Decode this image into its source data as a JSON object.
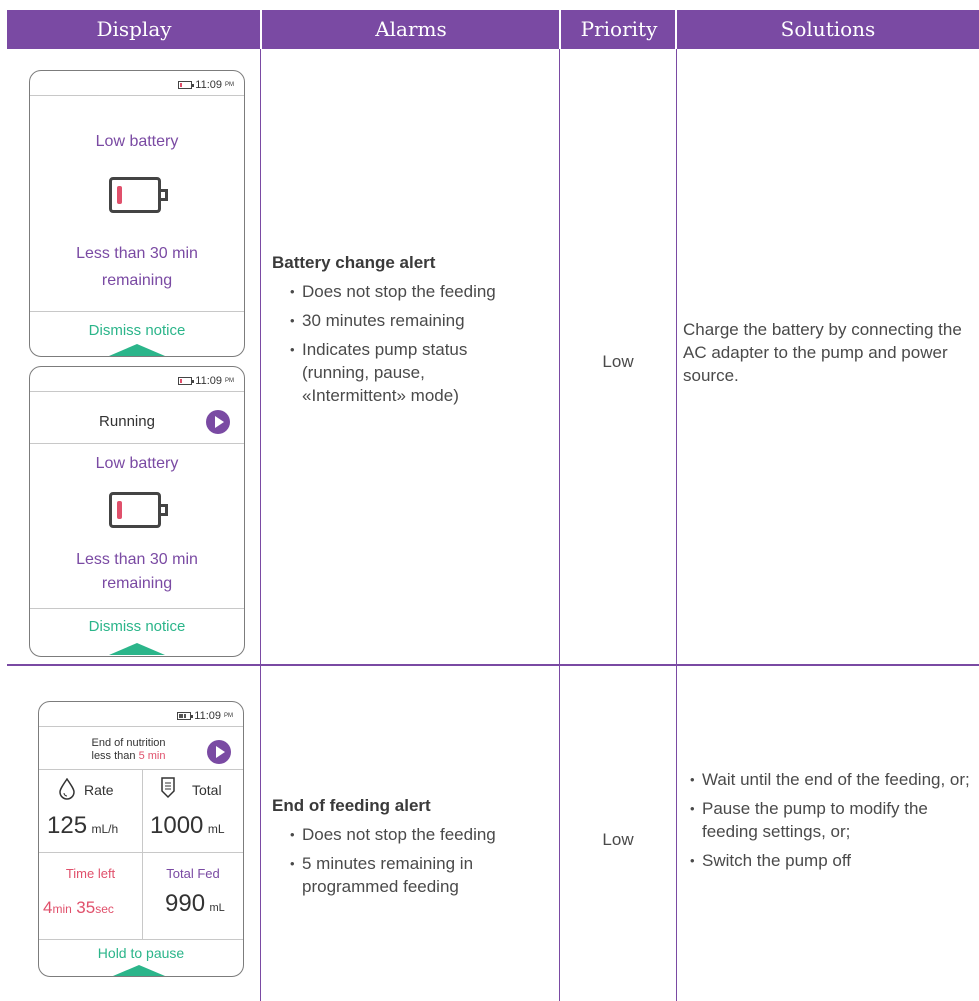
{
  "header": {
    "display": "Display",
    "alarms": "Alarms",
    "priority": "Priority",
    "solutions": "Solutions"
  },
  "colors": {
    "accent": "#7a4aa3",
    "green": "#2bb58a",
    "red": "#e0506b"
  },
  "row1": {
    "screen1": {
      "time": "11:09",
      "ampm": "PM",
      "title": "Low battery",
      "msg_line1": "Less than 30 min",
      "msg_line2": "remaining",
      "dismiss": "Dismiss notice"
    },
    "screen2": {
      "time": "11:09",
      "ampm": "PM",
      "status": "Running",
      "title": "Low battery",
      "msg_line1": "Less than 30 min",
      "msg_line2": "remaining",
      "dismiss": "Dismiss notice"
    },
    "alarm_title": "Battery change alert",
    "bullets": [
      "Does not stop the feeding",
      "30 minutes remaining",
      "Indicates pump status (running, pause, «Intermittent» mode)"
    ],
    "priority": "Low",
    "solution": "Charge the battery by connecting the AC adapter to the pump and power source."
  },
  "row2": {
    "screen": {
      "time": "11:09",
      "ampm": "PM",
      "status_line1": "End of nutrition",
      "status_line2_prefix": "less than ",
      "status_line2_highlight": "5 min",
      "rate_label": "Rate",
      "rate_value": "125",
      "rate_unit": "mL/h",
      "total_label": "Total",
      "total_value": "1000",
      "total_unit": "mL",
      "time_left_label": "Time left",
      "time_left_min": "4",
      "time_left_min_unit": "min",
      "time_left_sec": "35",
      "time_left_sec_unit": "sec",
      "total_fed_label": "Total Fed",
      "total_fed_value": "990",
      "total_fed_unit": "mL",
      "hold": "Hold to pause"
    },
    "alarm_title": "End of feeding alert",
    "bullets": [
      "Does not stop the feeding",
      "5 minutes remaining in programmed feeding"
    ],
    "priority": "Low",
    "solutions": [
      "Wait until the end of the feeding, or;",
      "Pause the pump to modify the feeding settings, or;",
      "Switch the pump off"
    ]
  }
}
